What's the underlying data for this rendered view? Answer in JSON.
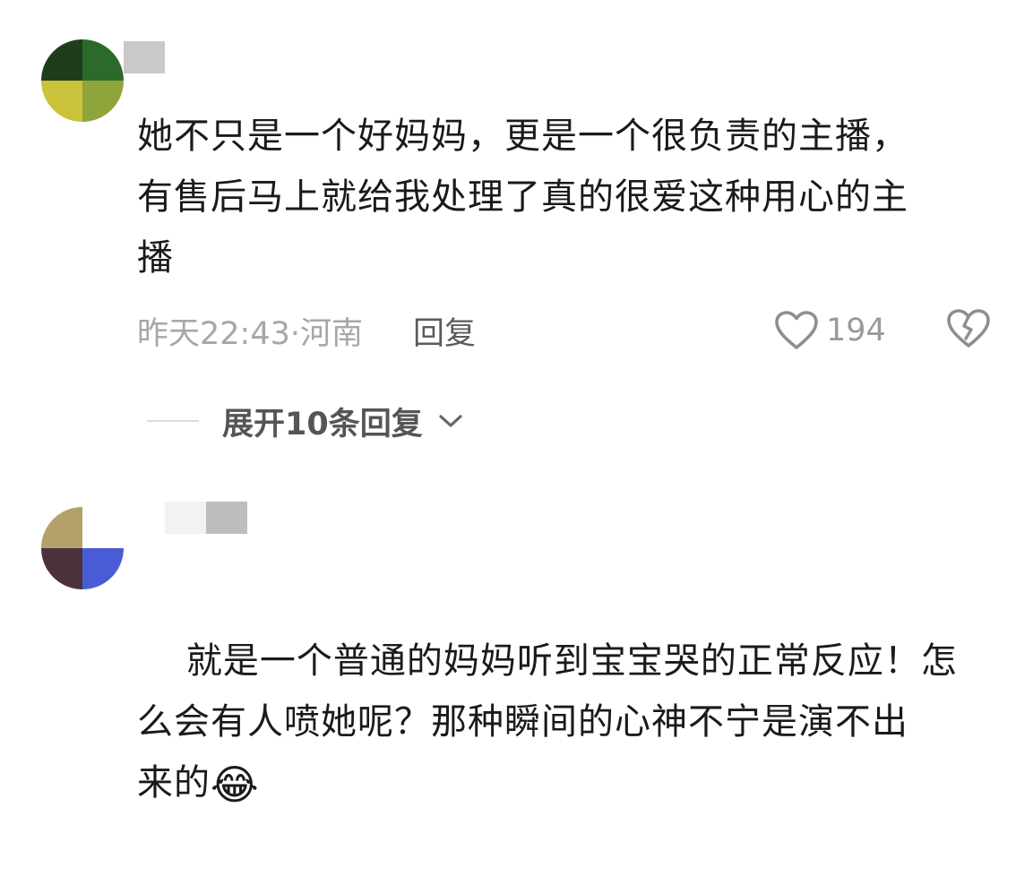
{
  "comments": [
    {
      "text": "她不只是一个好妈妈，更是一个很负责的主播，\n有售后马上就给我处理了真的很爱这种用心的主\n播",
      "meta": "昨天22:43·河南",
      "reply_label": "回复",
      "like_count": "194",
      "expand_label": "展开10条回复",
      "icons": {
        "like": "heart-outline-icon",
        "dislike": "broken-heart-icon",
        "expand": "chevron-down-icon"
      }
    },
    {
      "text": "就是一个普通的妈妈听到宝宝哭的正常反应！怎\n么会有人喷她呢？那种瞬间的心神不宁是演不出\n来的",
      "emoji": "😂",
      "emoji_name": "laughing-crying-emoji"
    }
  ],
  "colors": {
    "text": "#1a1a1a",
    "meta": "#a7a7a7",
    "reply": "#5a5a5a",
    "icon_stroke": "#8e8e8e"
  }
}
